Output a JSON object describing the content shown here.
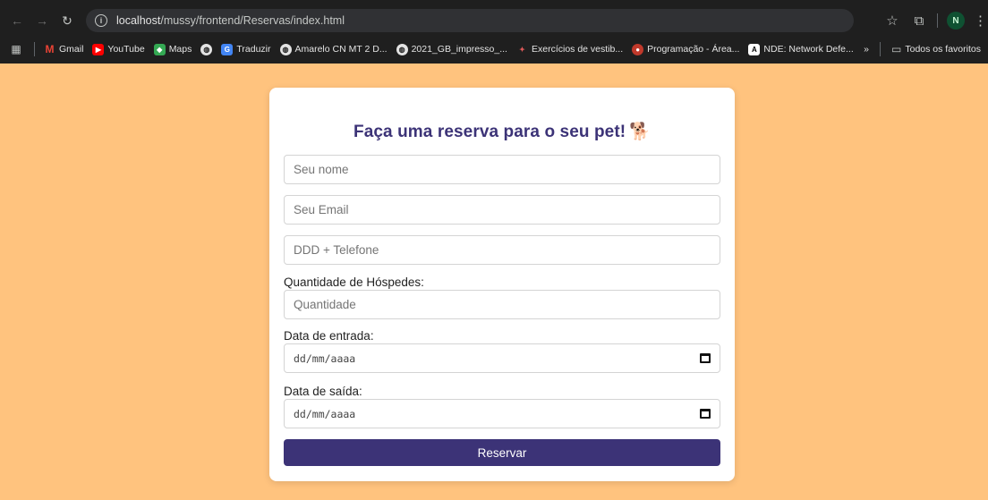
{
  "browser": {
    "url_host": "localhost",
    "url_path": "/mussy/frontend/Reservas/index.html",
    "profile_initial": "N",
    "bookmarks": [
      {
        "label": "Gmail"
      },
      {
        "label": "YouTube"
      },
      {
        "label": "Maps"
      },
      {
        "label": ""
      },
      {
        "label": "Traduzir"
      },
      {
        "label": "Amarelo CN MT 2 D..."
      },
      {
        "label": "2021_GB_impresso_..."
      },
      {
        "label": "Exercícios de vestib..."
      },
      {
        "label": "Programação - Área..."
      },
      {
        "label": "NDE: Network Defe..."
      }
    ],
    "more_bookmarks": "»",
    "all_favorites": "Todos os favoritos"
  },
  "form": {
    "title": "Faça uma reserva para o seu pet!",
    "title_emoji": "🐕",
    "name_placeholder": "Seu nome",
    "email_placeholder": "Seu Email",
    "phone_placeholder": "DDD + Telefone",
    "guests_label": "Quantidade de Hóspedes:",
    "guests_placeholder": "Quantidade",
    "checkin_label": "Data de entrada:",
    "checkin_value": "dd/mm/aaaa",
    "checkout_label": "Data de saída:",
    "checkout_value": "dd/mm/aaaa",
    "submit_label": "Reservar"
  },
  "colors": {
    "page_bg": "#ffc37e",
    "accent": "#3c3377"
  }
}
